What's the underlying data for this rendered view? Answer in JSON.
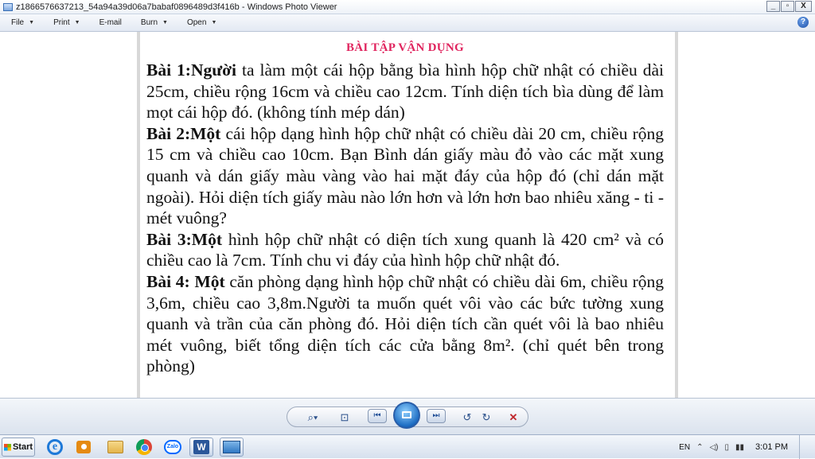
{
  "window": {
    "title": "z1866576637213_54a94a39d06a7babaf0896489d3f416b - Windows Photo Viewer",
    "buttons": {
      "minimize": "_",
      "maximize": "▫",
      "close": "X"
    }
  },
  "menu": {
    "items": [
      {
        "label": "File"
      },
      {
        "label": "Print"
      },
      {
        "label": "E-mail"
      },
      {
        "label": "Burn"
      },
      {
        "label": "Open"
      }
    ],
    "help": "?"
  },
  "document": {
    "heading": "BÀI TẬP VẬN DỤNG",
    "paragraphs": [
      {
        "lead": "Bài 1:Người",
        "body": " ta làm một cái hộp bằng bìa hình hộp chữ nhật có chiều dài 25cm, chiều rộng 16cm và chiều cao 12cm. Tính diện tích bìa dùng để làm mọt cái hộp đó. (không tính mép dán)"
      },
      {
        "lead": "Bài 2:Một",
        "body": " cái hộp dạng hình hộp chữ nhật có chiều dài 20 cm, chiều rộng 15 cm và chiều cao 10cm. Bạn Bình dán giấy màu đỏ vào các mặt xung quanh và dán giấy màu vàng vào hai mặt đáy của hộp đó (chỉ dán mặt ngoài). Hỏi diện tích giấy màu nào lớn hơn và lớn hơn bao nhiêu xăng - ti -mét vuông?"
      },
      {
        "lead": "Bài 3:Một",
        "body": " hình hộp chữ nhật có diện tích xung quanh là 420 cm² và có chiều cao là 7cm. Tính chu vi đáy của hình hộp chữ nhật đó."
      },
      {
        "lead": "Bài 4: Một",
        "body": " căn phòng dạng hình hộp chữ nhật có chiều dài 6m, chiều rộng 3,6m, chiều cao 3,8m.Người ta muốn quét vôi vào các bức tường xung quanh và trần của căn phòng đó. Hỏi diện tích cần quét vôi là bao nhiêu mét vuông, biết tổng diện tích các cửa bằng 8m². (chỉ quét bên trong phòng)"
      }
    ]
  },
  "controls": {
    "zoom": "⌕▾",
    "actual_size": "⊡",
    "previous": "⏮",
    "next": "⏭",
    "rotate_ccw": "↺",
    "rotate_cw": "↻",
    "delete": "✕"
  },
  "taskbar": {
    "start_label": "Start",
    "zalo_label": "Zalo",
    "word_label": "W",
    "language": "EN",
    "time": "3:01 PM"
  },
  "colors": {
    "heading": "#e0245e",
    "accent": "#1e6dc3"
  }
}
